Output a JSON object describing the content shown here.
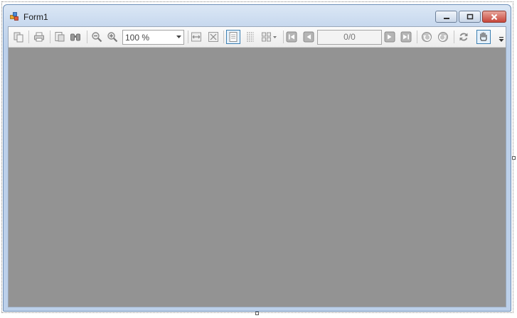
{
  "window": {
    "title": "Form1"
  },
  "toolbar": {
    "zoom": {
      "value": "100 %"
    },
    "page_counter": "0/0",
    "icons": [
      "copy-icon",
      "print-icon",
      "page-setup-icon",
      "find-icon",
      "zoom-out-icon",
      "zoom-in-icon",
      "page-width-icon",
      "whole-page-icon",
      "single-page-icon",
      "continuous-page-icon",
      "multipage-icon",
      "first-page-icon",
      "previous-page-icon",
      "next-page-icon",
      "last-page-icon",
      "back-icon",
      "forward-icon",
      "refresh-icon",
      "hand-tool-icon"
    ]
  },
  "colors": {
    "viewport_bg": "#939393",
    "toolbar_bg": "#f0f0f0",
    "title_bar": "#c7d8ee",
    "close_button": "#c7463a"
  }
}
